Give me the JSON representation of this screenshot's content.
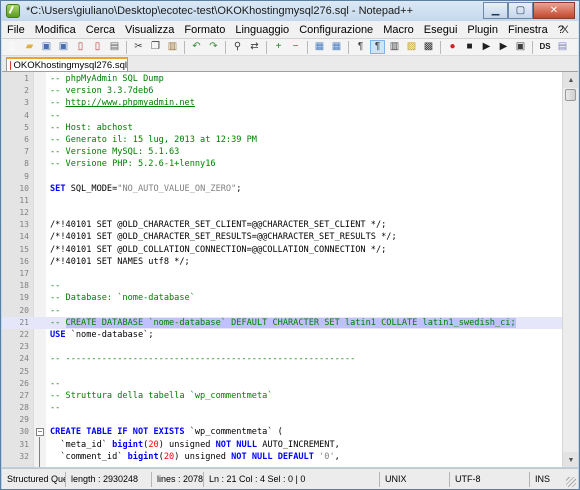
{
  "window": {
    "title": "*C:\\Users\\giuliano\\Desktop\\ecotec-test\\OKOKhostingmysql276.sql - Notepad++"
  },
  "menu": [
    "File",
    "Modifica",
    "Cerca",
    "Visualizza",
    "Formato",
    "Linguaggio",
    "Configurazione",
    "Macro",
    "Esegui",
    "Plugin",
    "Finestra",
    "?"
  ],
  "menu_close": "X",
  "toolbar": [
    {
      "name": "new-file-icon",
      "glyph": "▯",
      "color": "#ffffff"
    },
    {
      "name": "open-file-icon",
      "glyph": "▰",
      "color": "#e0b040"
    },
    {
      "name": "save-icon",
      "glyph": "▣",
      "color": "#4a70b0"
    },
    {
      "name": "save-all-icon",
      "glyph": "▣",
      "color": "#4a70b0"
    },
    {
      "name": "close-icon",
      "glyph": "▯",
      "color": "#c04040"
    },
    {
      "name": "close-all-icon",
      "glyph": "▯",
      "color": "#c04040"
    },
    {
      "name": "print-icon",
      "glyph": "▤",
      "color": "#606060"
    },
    {
      "sep": true
    },
    {
      "name": "cut-icon",
      "glyph": "✂",
      "color": "#404040"
    },
    {
      "name": "copy-icon",
      "glyph": "❐",
      "color": "#404040"
    },
    {
      "name": "paste-icon",
      "glyph": "▥",
      "color": "#9a7030"
    },
    {
      "sep": true
    },
    {
      "name": "undo-icon",
      "glyph": "↶",
      "color": "#3a8a3a"
    },
    {
      "name": "redo-icon",
      "glyph": "↷",
      "color": "#3a8a3a"
    },
    {
      "sep": true
    },
    {
      "name": "find-icon",
      "glyph": "⚲",
      "color": "#404040"
    },
    {
      "name": "replace-icon",
      "glyph": "⇄",
      "color": "#404040"
    },
    {
      "sep": true
    },
    {
      "name": "zoom-in-icon",
      "glyph": "+",
      "color": "#208020"
    },
    {
      "name": "zoom-out-icon",
      "glyph": "−",
      "color": "#c03030"
    },
    {
      "sep": true
    },
    {
      "name": "sync-v-icon",
      "glyph": "▦",
      "color": "#5080c0"
    },
    {
      "name": "sync-h-icon",
      "glyph": "▦",
      "color": "#5080c0"
    },
    {
      "sep": true
    },
    {
      "name": "word-wrap-icon",
      "glyph": "¶",
      "color": "#404040"
    },
    {
      "name": "all-chars-icon",
      "glyph": "¶",
      "color": "#404040",
      "active": true
    },
    {
      "name": "indent-guide-icon",
      "glyph": "▥",
      "color": "#404040"
    },
    {
      "name": "udl-icon",
      "glyph": "▨",
      "color": "#c0a020"
    },
    {
      "name": "doc-map-icon",
      "glyph": "▩",
      "color": "#404040"
    },
    {
      "sep": true
    },
    {
      "name": "record-macro-icon",
      "glyph": "●",
      "color": "#d02020"
    },
    {
      "name": "stop-macro-icon",
      "glyph": "■",
      "color": "#202020"
    },
    {
      "name": "play-macro-icon",
      "glyph": "▶",
      "color": "#202020"
    },
    {
      "name": "play-multiple-icon",
      "glyph": "▶",
      "color": "#202020"
    },
    {
      "name": "save-macro-icon",
      "glyph": "▣",
      "color": "#404040"
    },
    {
      "sep": true
    },
    {
      "name": "spellcheck-icon",
      "glyph": "DS",
      "color": "#202020"
    },
    {
      "name": "plugin-icon",
      "glyph": "▤",
      "color": "#8080c0"
    }
  ],
  "tab": {
    "label": "OKOKhostingmysql276.sql"
  },
  "editor": {
    "lines": [
      {
        "n": "1",
        "t": [
          [
            "comment",
            "-- phpMyAdmin SQL Dump"
          ]
        ]
      },
      {
        "n": "2",
        "t": [
          [
            "comment",
            "-- version 3.3.7deb6"
          ]
        ]
      },
      {
        "n": "3",
        "t": [
          [
            "comment",
            "-- "
          ],
          [
            "link",
            "http://www.phpmyadmin.net"
          ]
        ]
      },
      {
        "n": "4",
        "t": [
          [
            "comment",
            "--"
          ]
        ]
      },
      {
        "n": "5",
        "t": [
          [
            "comment",
            "-- Host: abchost"
          ]
        ]
      },
      {
        "n": "6",
        "t": [
          [
            "comment",
            "-- Generato il: 15 lug, 2013 at 12:39 PM"
          ]
        ]
      },
      {
        "n": "7",
        "t": [
          [
            "comment",
            "-- Versione MySQL: 5.1.63"
          ]
        ]
      },
      {
        "n": "8",
        "t": [
          [
            "comment",
            "-- Versione PHP: 5.2.6-1+lenny16"
          ]
        ]
      },
      {
        "n": "9",
        "t": []
      },
      {
        "n": "10",
        "t": [
          [
            "keyword",
            "SET"
          ],
          [
            "plain",
            " SQL_MODE="
          ],
          [
            "string",
            "\"NO_AUTO_VALUE_ON_ZERO\""
          ],
          [
            "plain",
            ";"
          ]
        ]
      },
      {
        "n": "11",
        "t": []
      },
      {
        "n": "12",
        "t": []
      },
      {
        "n": "13",
        "t": [
          [
            "plain",
            "/*!40101 SET @OLD_CHARACTER_SET_CLIENT=@@CHARACTER_SET_CLIENT */;"
          ]
        ]
      },
      {
        "n": "14",
        "t": [
          [
            "plain",
            "/*!40101 SET @OLD_CHARACTER_SET_RESULTS=@@CHARACTER_SET_RESULTS */;"
          ]
        ]
      },
      {
        "n": "15",
        "t": [
          [
            "plain",
            "/*!40101 SET @OLD_COLLATION_CONNECTION=@@COLLATION_CONNECTION */;"
          ]
        ]
      },
      {
        "n": "16",
        "t": [
          [
            "plain",
            "/*!40101 SET NAMES utf8 */;"
          ]
        ]
      },
      {
        "n": "17",
        "t": []
      },
      {
        "n": "18",
        "t": [
          [
            "comment",
            "--"
          ]
        ]
      },
      {
        "n": "19",
        "t": [
          [
            "comment",
            "-- Database: `nome-database`"
          ]
        ]
      },
      {
        "n": "20",
        "t": [
          [
            "comment",
            "--"
          ]
        ]
      },
      {
        "n": "21",
        "current": true,
        "t": [
          [
            "comment",
            "-- "
          ],
          [
            "sel",
            "CREATE DATABASE `nome-database` DEFAULT CHARACTER SET latin1 COLLATE latin1_swedish_ci;"
          ]
        ]
      },
      {
        "n": "22",
        "t": [
          [
            "keyword",
            "USE"
          ],
          [
            "plain",
            " `nome-database`;"
          ]
        ]
      },
      {
        "n": "23",
        "t": []
      },
      {
        "n": "24",
        "t": [
          [
            "comment",
            "-- --------------------------------------------------------"
          ]
        ]
      },
      {
        "n": "25",
        "t": []
      },
      {
        "n": "26",
        "t": [
          [
            "comment",
            "--"
          ]
        ]
      },
      {
        "n": "27",
        "t": [
          [
            "comment",
            "-- Struttura della tabella `wp_commentmeta`"
          ]
        ]
      },
      {
        "n": "28",
        "t": [
          [
            "comment",
            "--"
          ]
        ]
      },
      {
        "n": "29",
        "t": []
      },
      {
        "n": "30",
        "fold": true,
        "t": [
          [
            "keyword",
            "CREATE TABLE IF NOT EXISTS"
          ],
          [
            "plain",
            " `wp_commentmeta` ("
          ]
        ]
      },
      {
        "n": "31",
        "t": [
          [
            "plain",
            "  `meta_id` "
          ],
          [
            "keyword",
            "bigint"
          ],
          [
            "plain",
            "("
          ],
          [
            "number",
            "20"
          ],
          [
            "plain",
            ") unsigned "
          ],
          [
            "keyword",
            "NOT NULL"
          ],
          [
            "plain",
            " AUTO_INCREMENT,"
          ]
        ]
      },
      {
        "n": "32",
        "t": [
          [
            "plain",
            "  `comment_id` "
          ],
          [
            "keyword",
            "bigint"
          ],
          [
            "plain",
            "("
          ],
          [
            "number",
            "20"
          ],
          [
            "plain",
            ") unsigned "
          ],
          [
            "keyword",
            "NOT NULL DEFAULT"
          ],
          [
            "plain",
            " "
          ],
          [
            "string",
            "'0'"
          ],
          [
            "plain",
            ","
          ]
        ]
      }
    ]
  },
  "status": {
    "type": "Structured Quer",
    "length": "length : 2930248",
    "lines": "lines : 2078",
    "position": "Ln : 21   Col : 4   Sel : 0 | 0",
    "eol": "UNIX",
    "encoding": "UTF-8",
    "mode": "INS"
  }
}
